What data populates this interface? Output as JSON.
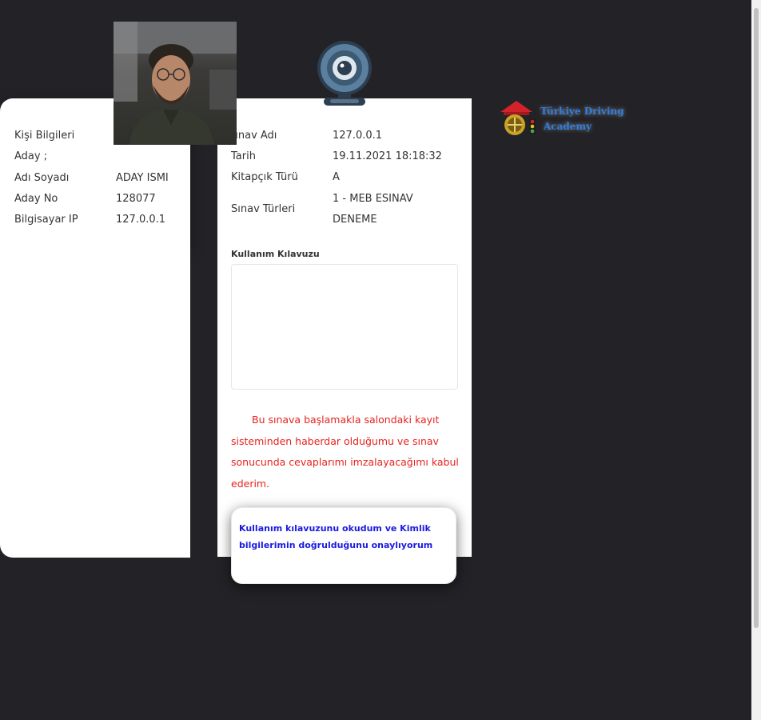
{
  "candidate": {
    "section_title": "Kişi Bilgileri",
    "candidate_label": "Aday ;",
    "rows": [
      {
        "label": "Adı Soyadı",
        "value": "ADAY ISMI"
      },
      {
        "label": "Aday No",
        "value": "128077"
      },
      {
        "label": "Bilgisayar IP",
        "value": "127.0.0.1"
      }
    ]
  },
  "exam": {
    "rows": [
      {
        "label": "Sınav Adı",
        "value": "127.0.0.1"
      },
      {
        "label": "Tarih",
        "value": "19.11.2021 18:18:32"
      },
      {
        "label": "Kitapçık Türü",
        "value": "A"
      },
      {
        "label": "Sınav Türleri",
        "value_lines": [
          "1 - MEB ESINAV",
          "DENEME"
        ]
      }
    ]
  },
  "guide": {
    "title": "Kullanım Kılavuzu"
  },
  "consent_text": "Bu sınava başlamakla salondaki kayıt sisteminden haberdar olduğumu ve sınav sonucunda cevaplarımı imzalayacağımı kabul ederim.",
  "confirm_button": {
    "label": "Kullanım kılavuzunu okudum ve Kimlik bilgilerimin doğrulduğunu onaylıyorum"
  },
  "logo": {
    "line1": "Türkiye Driving",
    "line2": "Academy"
  },
  "colors": {
    "background": "#232226",
    "consent_red": "#e6231f",
    "confirm_blue": "#1a1ae0",
    "logo_blue": "#2f7fe0"
  }
}
